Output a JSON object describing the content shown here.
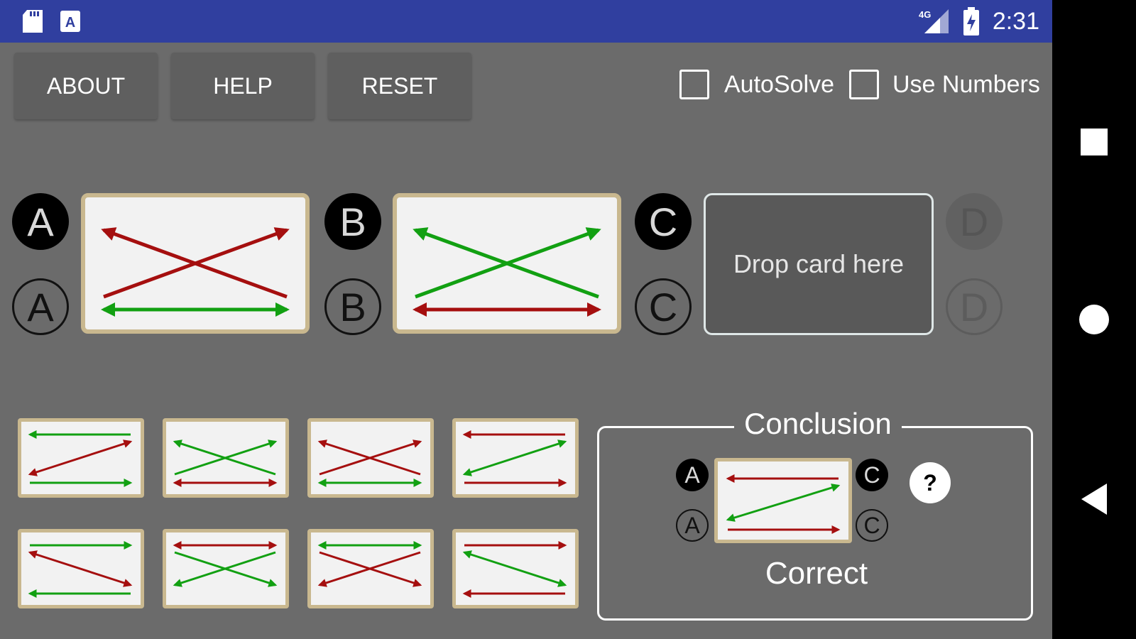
{
  "status_bar": {
    "time": "2:31",
    "network": "4G",
    "icons": [
      "sd-card-icon",
      "keyboard-a-icon",
      "signal-icon",
      "battery-charging-icon"
    ],
    "background": "#303f9f"
  },
  "nav_bar": {
    "icons": [
      "recent-apps-square-icon",
      "home-circle-icon",
      "back-triangle-icon"
    ]
  },
  "toolbar": {
    "about_label": "ABOUT",
    "help_label": "HELP",
    "reset_label": "RESET",
    "autosolve_label": "AutoSolve",
    "use_numbers_label": "Use Numbers",
    "autosolve_checked": false,
    "use_numbers_checked": false
  },
  "slots": [
    {
      "letter": "A",
      "state": "filled"
    },
    {
      "letter": "B",
      "state": "filled"
    },
    {
      "letter": "C",
      "state": "empty"
    },
    {
      "letter": "D",
      "state": "disabled"
    }
  ],
  "dropzone": {
    "label": "Drop card here"
  },
  "conclusion": {
    "title": "Conclusion",
    "left_letter": "A",
    "right_letter": "C",
    "help_label": "?",
    "result": "Correct"
  },
  "colors": {
    "red": "#a50f0f",
    "green": "#12a012",
    "card_border": "#c9b88f",
    "card_bg": "#f2f2f2"
  }
}
